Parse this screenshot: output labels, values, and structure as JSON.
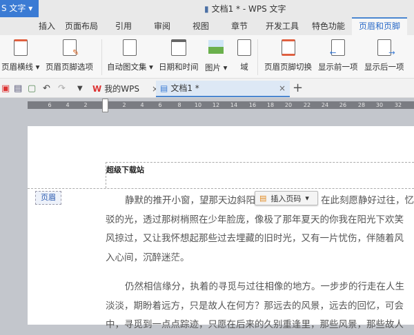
{
  "app": {
    "menu_label": "S 文字",
    "title": "文档1 * - WPS 文字"
  },
  "tabs": [
    "插入",
    "页面布局",
    "引用",
    "审阅",
    "视图",
    "章节",
    "开发工具",
    "特色功能",
    "页眉和页脚"
  ],
  "ribbon": [
    "页眉横线",
    "页眉页脚选项",
    "自动图文集",
    "日期和时间",
    "图片",
    "域",
    "页眉页脚切换",
    "显示前一项",
    "显示后一项"
  ],
  "doc_tabs": {
    "home": "我的WPS",
    "doc": "文档1 *",
    "close": "×",
    "add": "+"
  },
  "ruler": [
    "6",
    "4",
    "2",
    "2",
    "4",
    "6",
    "8",
    "10",
    "12",
    "14",
    "16",
    "18",
    "20",
    "22",
    "24",
    "26",
    "28",
    "30",
    "32"
  ],
  "header": {
    "text": "超级下载站",
    "label": "页眉",
    "insert_page_number": "插入页码"
  },
  "body": {
    "p1": [
      "静默的推开小窗，望那天边斜阳",
      "在此刻愿静好过往，忆",
      "驳的光，透过那树梢照在少年脸庞，像极了那年夏天的你我在阳光下欢笑",
      "风掠过，又让我怀想起那些过去埋藏的旧时光，又有一片忧伤，伴随着风",
      "入心间，沉醉迷茫。"
    ],
    "p2": [
      "仍然相信缘分，执着的寻觅与过往相像的地方。一步步的行走在人生",
      "淡淡，期盼着远方，只是故人在何方？那远去的风景，远去的回忆，可会",
      "中，寻觅到一点点踪迹，只愿在后来的久别重逢里，那些风景，那些故人"
    ]
  },
  "colors": {
    "accent": "#3b7bd4",
    "ruler": "#7a7c82",
    "workspace": "#c3c6cc"
  }
}
